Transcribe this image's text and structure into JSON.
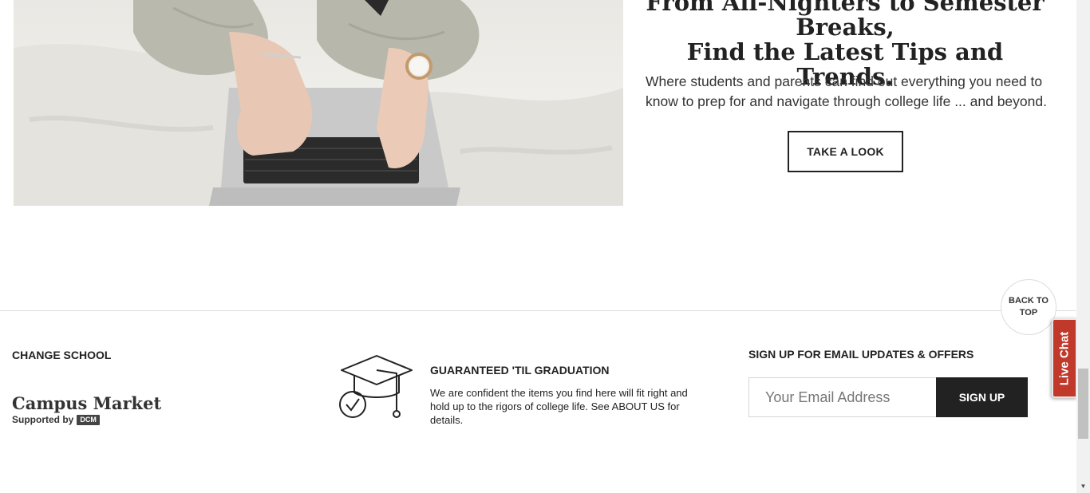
{
  "hero": {
    "title_line1": "From All-Nighters to Semester",
    "title_line2": "Breaks,",
    "title_line3": "Find the Latest Tips and Trends.",
    "description": "Where students and parents can find out everything you need to know to prep for and navigate through college life ... and beyond.",
    "cta_label": "TAKE A LOOK"
  },
  "footer": {
    "back_to_top_label": "BACK TO TOP",
    "change_school_label": "CHANGE SCHOOL",
    "logo": {
      "brand": "Campus Market",
      "supported_by": "Supported by",
      "badge": "DCM"
    },
    "guarantee": {
      "title": "GUARANTEED 'TIL GRADUATION",
      "text": "We are confident the items you find here will fit right and hold up to the rigors of college life. See ABOUT US for details.",
      "icon": "graduation-cap-check-icon"
    },
    "signup": {
      "title": "SIGN UP FOR EMAIL UPDATES & OFFERS",
      "email_placeholder": "Your Email Address",
      "button_label": "SIGN UP"
    }
  },
  "live_chat_label": "Live Chat",
  "colors": {
    "live_chat_bg": "#c0392b",
    "signup_button_bg": "#222222",
    "text": "#222222"
  }
}
